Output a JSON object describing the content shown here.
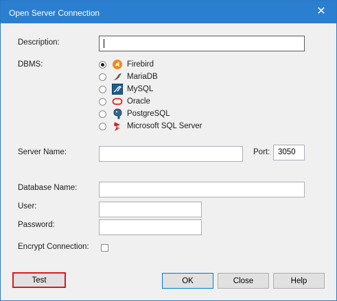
{
  "window": {
    "title": "Open Server Connection",
    "close_glyph": "✕"
  },
  "form": {
    "description_label": "Description:",
    "description_value": "",
    "dbms_label": "DBMS:",
    "dbms_options": [
      {
        "label": "Firebird",
        "icon": "firebird-icon",
        "selected": true
      },
      {
        "label": "MariaDB",
        "icon": "mariadb-icon",
        "selected": false
      },
      {
        "label": "MySQL",
        "icon": "mysql-icon",
        "selected": false
      },
      {
        "label": "Oracle",
        "icon": "oracle-icon",
        "selected": false
      },
      {
        "label": "PostgreSQL",
        "icon": "postgresql-icon",
        "selected": false
      },
      {
        "label": "Microsoft SQL Server",
        "icon": "sqlserver-icon",
        "selected": false
      }
    ],
    "server_name_label": "Server Name:",
    "server_name_value": "",
    "port_label": "Port:",
    "port_value": "3050",
    "database_name_label": "Database Name:",
    "database_name_value": "",
    "user_label": "User:",
    "user_value": "",
    "password_label": "Password:",
    "password_value": "",
    "encrypt_label": "Encrypt Connection:",
    "encrypt_checked": false
  },
  "buttons": {
    "test": "Test",
    "ok": "OK",
    "close": "Close",
    "help": "Help"
  },
  "colors": {
    "titlebar": "#2b7fd0",
    "highlight": "#e0141e",
    "default_border": "#0078d7"
  }
}
